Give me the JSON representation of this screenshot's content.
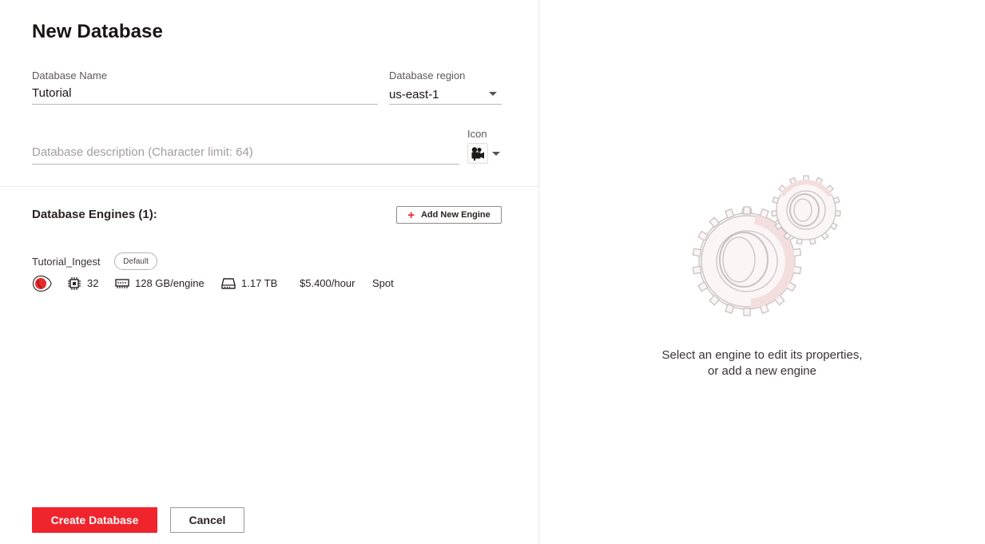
{
  "page": {
    "title": "New Database"
  },
  "form": {
    "name_label": "Database Name",
    "name_value": "Tutorial",
    "region_label": "Database region",
    "region_value": "us-east-1",
    "description_placeholder": "Database description (Character limit: 64)",
    "icon_label": "Icon",
    "icon_name": "movie-camera-icon"
  },
  "engines": {
    "section_title": "Database Engines (1):",
    "add_button_label": "Add New Engine",
    "items": [
      {
        "name": "Tutorial_Ingest",
        "badge": "Default",
        "status_icon": "engine-status-icon",
        "cpu": "32",
        "memory": "128 GB/engine",
        "storage": "1.17 TB",
        "price": "$5.400/hour",
        "instance_type": "Spot"
      }
    ]
  },
  "actions": {
    "create_label": "Create Database",
    "cancel_label": "Cancel"
  },
  "right_panel": {
    "illustration": "gears-illustration",
    "hint_line1": "Select an engine to edit its properties,",
    "hint_line2": "or add a new engine"
  },
  "colors": {
    "accent": "#f0242c",
    "text": "#1c1414",
    "muted": "#5e5858"
  }
}
